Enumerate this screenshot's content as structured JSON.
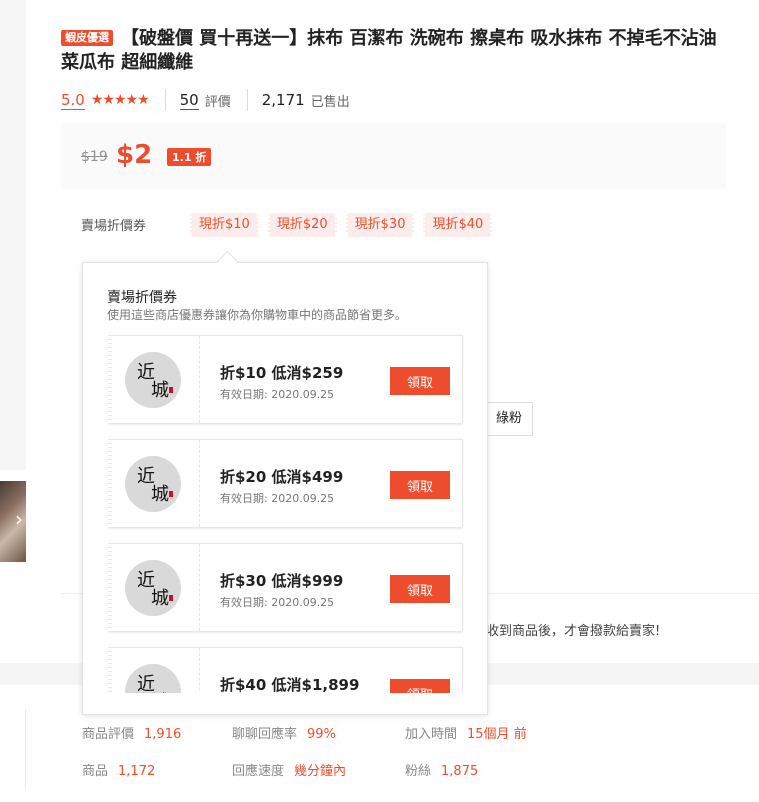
{
  "product": {
    "badge": "蝦皮優選",
    "title": "【破盤價 買十再送一】抹布 百潔布 洗碗布 擦桌布 吸水抹布 不掉毛不沾油 菜瓜布 超細纖維"
  },
  "rating": {
    "score": "5.0",
    "stars": "★★★★★",
    "review_count": "50",
    "review_label": "評價",
    "sold_count": "2,171",
    "sold_label": "已售出"
  },
  "price": {
    "original": "$19",
    "current": "$2",
    "discount": "1.1 折"
  },
  "voucher_row": {
    "label": "賣場折價券",
    "chips": [
      "現折$10",
      "現折$20",
      "現折$30",
      "現折$40"
    ]
  },
  "behind": {
    "variant_tail": "綠粉",
    "guarantee_text": "收到商品後，才會撥款給賣家!"
  },
  "popover": {
    "title": "賣場折價券",
    "subtitle": "使用這些商店優惠券讓你為你購物車中的商品節省更多。",
    "logo_chars": [
      "近",
      "城"
    ],
    "vouchers": [
      {
        "title": "折$10 低消$259",
        "date": "有效日期: 2020.09.25",
        "button": "領取"
      },
      {
        "title": "折$20 低消$499",
        "date": "有效日期: 2020.09.25",
        "button": "領取"
      },
      {
        "title": "折$30 低消$999",
        "date": "有效日期: 2020.09.25",
        "button": "領取"
      },
      {
        "title": "折$40 低消$1,899",
        "date": "",
        "button": "領取"
      }
    ]
  },
  "shop_stats": [
    {
      "label": "商品評價",
      "value": "1,916"
    },
    {
      "label": "聊聊回應率",
      "value": "99%"
    },
    {
      "label": "加入時間",
      "value": "15個月 前"
    },
    {
      "label": "商品",
      "value": "1,172"
    },
    {
      "label": "回應速度",
      "value": "幾分鐘內"
    },
    {
      "label": "粉絲",
      "value": "1,875"
    }
  ],
  "colors": {
    "accent": "#ee4d2d",
    "chip_bg": "#fdecec",
    "price_bg": "#fafafa"
  }
}
